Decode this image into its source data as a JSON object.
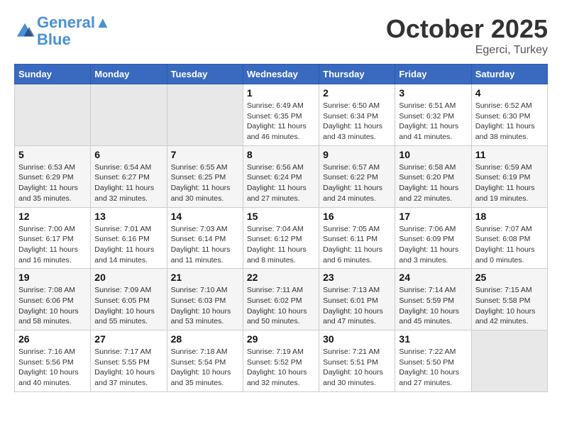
{
  "header": {
    "logo_line1": "General",
    "logo_line2": "Blue",
    "month": "October 2025",
    "location": "Egerci, Turkey"
  },
  "weekdays": [
    "Sunday",
    "Monday",
    "Tuesday",
    "Wednesday",
    "Thursday",
    "Friday",
    "Saturday"
  ],
  "weeks": [
    [
      {
        "day": "",
        "sunrise": "",
        "sunset": "",
        "daylight": "",
        "empty": true
      },
      {
        "day": "",
        "sunrise": "",
        "sunset": "",
        "daylight": "",
        "empty": true
      },
      {
        "day": "",
        "sunrise": "",
        "sunset": "",
        "daylight": "",
        "empty": true
      },
      {
        "day": "1",
        "sunrise": "6:49 AM",
        "sunset": "6:35 PM",
        "daylight": "11 hours and 46 minutes."
      },
      {
        "day": "2",
        "sunrise": "6:50 AM",
        "sunset": "6:34 PM",
        "daylight": "11 hours and 43 minutes."
      },
      {
        "day": "3",
        "sunrise": "6:51 AM",
        "sunset": "6:32 PM",
        "daylight": "11 hours and 41 minutes."
      },
      {
        "day": "4",
        "sunrise": "6:52 AM",
        "sunset": "6:30 PM",
        "daylight": "11 hours and 38 minutes."
      }
    ],
    [
      {
        "day": "5",
        "sunrise": "6:53 AM",
        "sunset": "6:29 PM",
        "daylight": "11 hours and 35 minutes."
      },
      {
        "day": "6",
        "sunrise": "6:54 AM",
        "sunset": "6:27 PM",
        "daylight": "11 hours and 32 minutes."
      },
      {
        "day": "7",
        "sunrise": "6:55 AM",
        "sunset": "6:25 PM",
        "daylight": "11 hours and 30 minutes."
      },
      {
        "day": "8",
        "sunrise": "6:56 AM",
        "sunset": "6:24 PM",
        "daylight": "11 hours and 27 minutes."
      },
      {
        "day": "9",
        "sunrise": "6:57 AM",
        "sunset": "6:22 PM",
        "daylight": "11 hours and 24 minutes."
      },
      {
        "day": "10",
        "sunrise": "6:58 AM",
        "sunset": "6:20 PM",
        "daylight": "11 hours and 22 minutes."
      },
      {
        "day": "11",
        "sunrise": "6:59 AM",
        "sunset": "6:19 PM",
        "daylight": "11 hours and 19 minutes."
      }
    ],
    [
      {
        "day": "12",
        "sunrise": "7:00 AM",
        "sunset": "6:17 PM",
        "daylight": "11 hours and 16 minutes."
      },
      {
        "day": "13",
        "sunrise": "7:01 AM",
        "sunset": "6:16 PM",
        "daylight": "11 hours and 14 minutes."
      },
      {
        "day": "14",
        "sunrise": "7:03 AM",
        "sunset": "6:14 PM",
        "daylight": "11 hours and 11 minutes."
      },
      {
        "day": "15",
        "sunrise": "7:04 AM",
        "sunset": "6:12 PM",
        "daylight": "11 hours and 8 minutes."
      },
      {
        "day": "16",
        "sunrise": "7:05 AM",
        "sunset": "6:11 PM",
        "daylight": "11 hours and 6 minutes."
      },
      {
        "day": "17",
        "sunrise": "7:06 AM",
        "sunset": "6:09 PM",
        "daylight": "11 hours and 3 minutes."
      },
      {
        "day": "18",
        "sunrise": "7:07 AM",
        "sunset": "6:08 PM",
        "daylight": "11 hours and 0 minutes."
      }
    ],
    [
      {
        "day": "19",
        "sunrise": "7:08 AM",
        "sunset": "6:06 PM",
        "daylight": "10 hours and 58 minutes."
      },
      {
        "day": "20",
        "sunrise": "7:09 AM",
        "sunset": "6:05 PM",
        "daylight": "10 hours and 55 minutes."
      },
      {
        "day": "21",
        "sunrise": "7:10 AM",
        "sunset": "6:03 PM",
        "daylight": "10 hours and 53 minutes."
      },
      {
        "day": "22",
        "sunrise": "7:11 AM",
        "sunset": "6:02 PM",
        "daylight": "10 hours and 50 minutes."
      },
      {
        "day": "23",
        "sunrise": "7:13 AM",
        "sunset": "6:01 PM",
        "daylight": "10 hours and 47 minutes."
      },
      {
        "day": "24",
        "sunrise": "7:14 AM",
        "sunset": "5:59 PM",
        "daylight": "10 hours and 45 minutes."
      },
      {
        "day": "25",
        "sunrise": "7:15 AM",
        "sunset": "5:58 PM",
        "daylight": "10 hours and 42 minutes."
      }
    ],
    [
      {
        "day": "26",
        "sunrise": "7:16 AM",
        "sunset": "5:56 PM",
        "daylight": "10 hours and 40 minutes."
      },
      {
        "day": "27",
        "sunrise": "7:17 AM",
        "sunset": "5:55 PM",
        "daylight": "10 hours and 37 minutes."
      },
      {
        "day": "28",
        "sunrise": "7:18 AM",
        "sunset": "5:54 PM",
        "daylight": "10 hours and 35 minutes."
      },
      {
        "day": "29",
        "sunrise": "7:19 AM",
        "sunset": "5:52 PM",
        "daylight": "10 hours and 32 minutes."
      },
      {
        "day": "30",
        "sunrise": "7:21 AM",
        "sunset": "5:51 PM",
        "daylight": "10 hours and 30 minutes."
      },
      {
        "day": "31",
        "sunrise": "7:22 AM",
        "sunset": "5:50 PM",
        "daylight": "10 hours and 27 minutes."
      },
      {
        "day": "",
        "sunrise": "",
        "sunset": "",
        "daylight": "",
        "empty": true
      }
    ]
  ],
  "labels": {
    "sunrise_prefix": "Sunrise: ",
    "sunset_prefix": "Sunset: ",
    "daylight_prefix": "Daylight: "
  }
}
